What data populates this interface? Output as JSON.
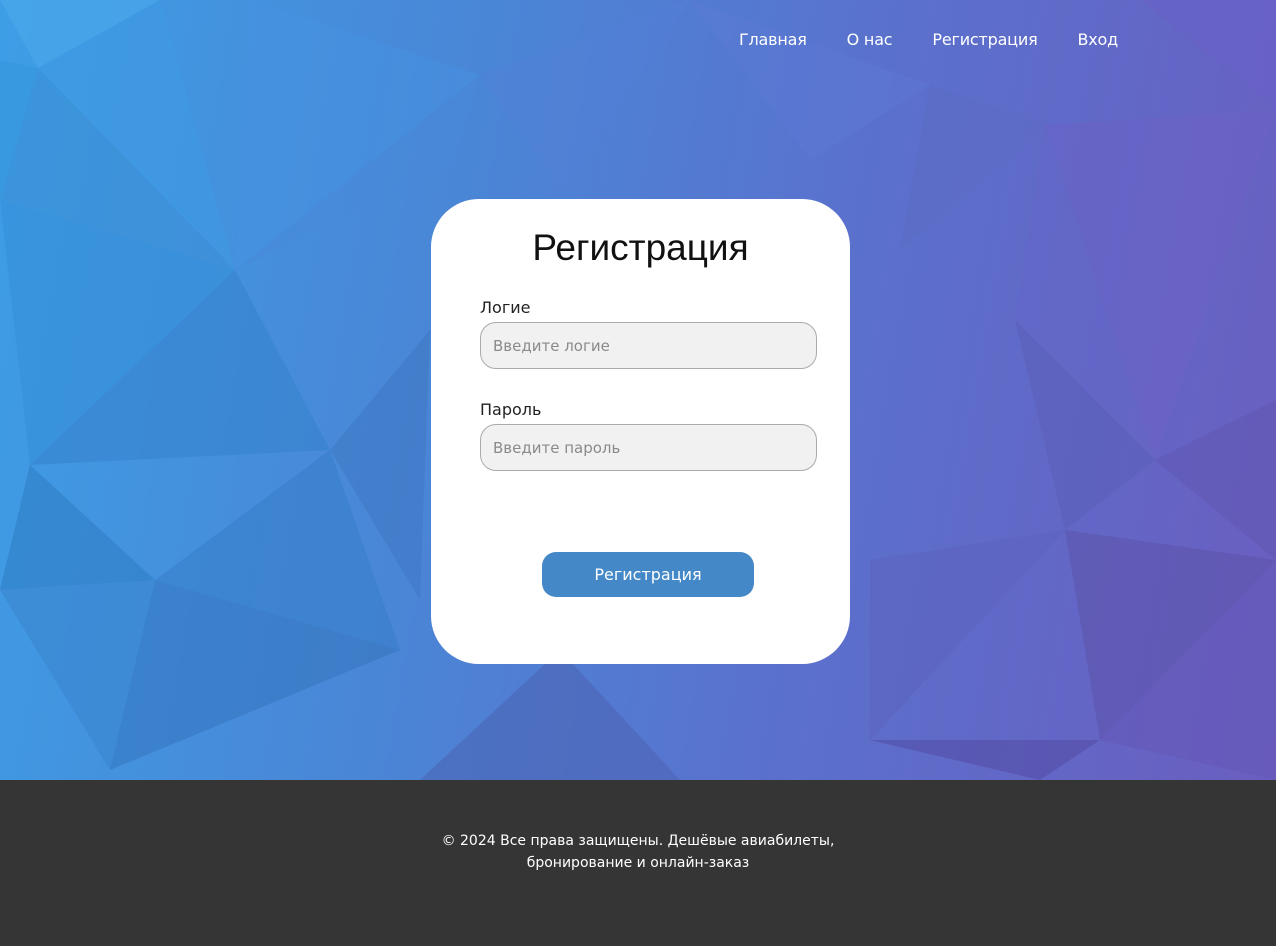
{
  "nav": {
    "items": [
      "Главная",
      "О нас",
      "Регистрация",
      "Вход"
    ]
  },
  "form": {
    "title": "Регистрация",
    "login": {
      "label": "Логие",
      "placeholder": "Введите логие"
    },
    "password": {
      "label": "Пароль",
      "placeholder": "Введите пароль"
    },
    "submit_label": "Регистрация"
  },
  "footer": {
    "line1": "© 2024 Все права защищены. Дешёвые авиабилеты,",
    "line2": "бронирование и онлайн-заказ"
  },
  "colors": {
    "accent": "#4488c8",
    "footer_bg": "#353535",
    "card_bg": "#ffffff"
  }
}
